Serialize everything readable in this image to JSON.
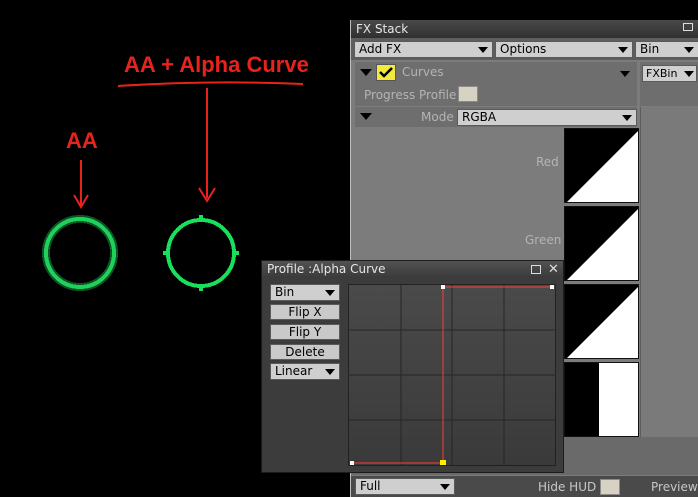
{
  "annotations": {
    "aa_label": "AA",
    "aa_alpha_label": "AA + Alpha Curve"
  },
  "fx_stack": {
    "title": "FX Stack",
    "add_fx": "Add FX",
    "options": "Options",
    "bin": "Bin",
    "effect_name": "Curves",
    "fxbin": "FXBin",
    "progress_profile_label": "Progress Profile",
    "mode_label": "Mode",
    "mode_value": "RGBA",
    "channels": [
      "Red",
      "Green"
    ],
    "bottom": {
      "size_select": "Full",
      "hide_hud_label": "Hide HUD",
      "preview_label": "Preview"
    }
  },
  "profile": {
    "title": "Profile :Alpha Curve",
    "bin_select": "Bin",
    "flip_x": "Flip X",
    "flip_y": "Flip Y",
    "delete": "Delete",
    "interp_select": "Linear"
  },
  "colors": {
    "annotation": "#e8231d",
    "circle_green": "#17e05a",
    "curve_line": "#ff3b3b",
    "curve_point_selected": "#ffee00"
  }
}
